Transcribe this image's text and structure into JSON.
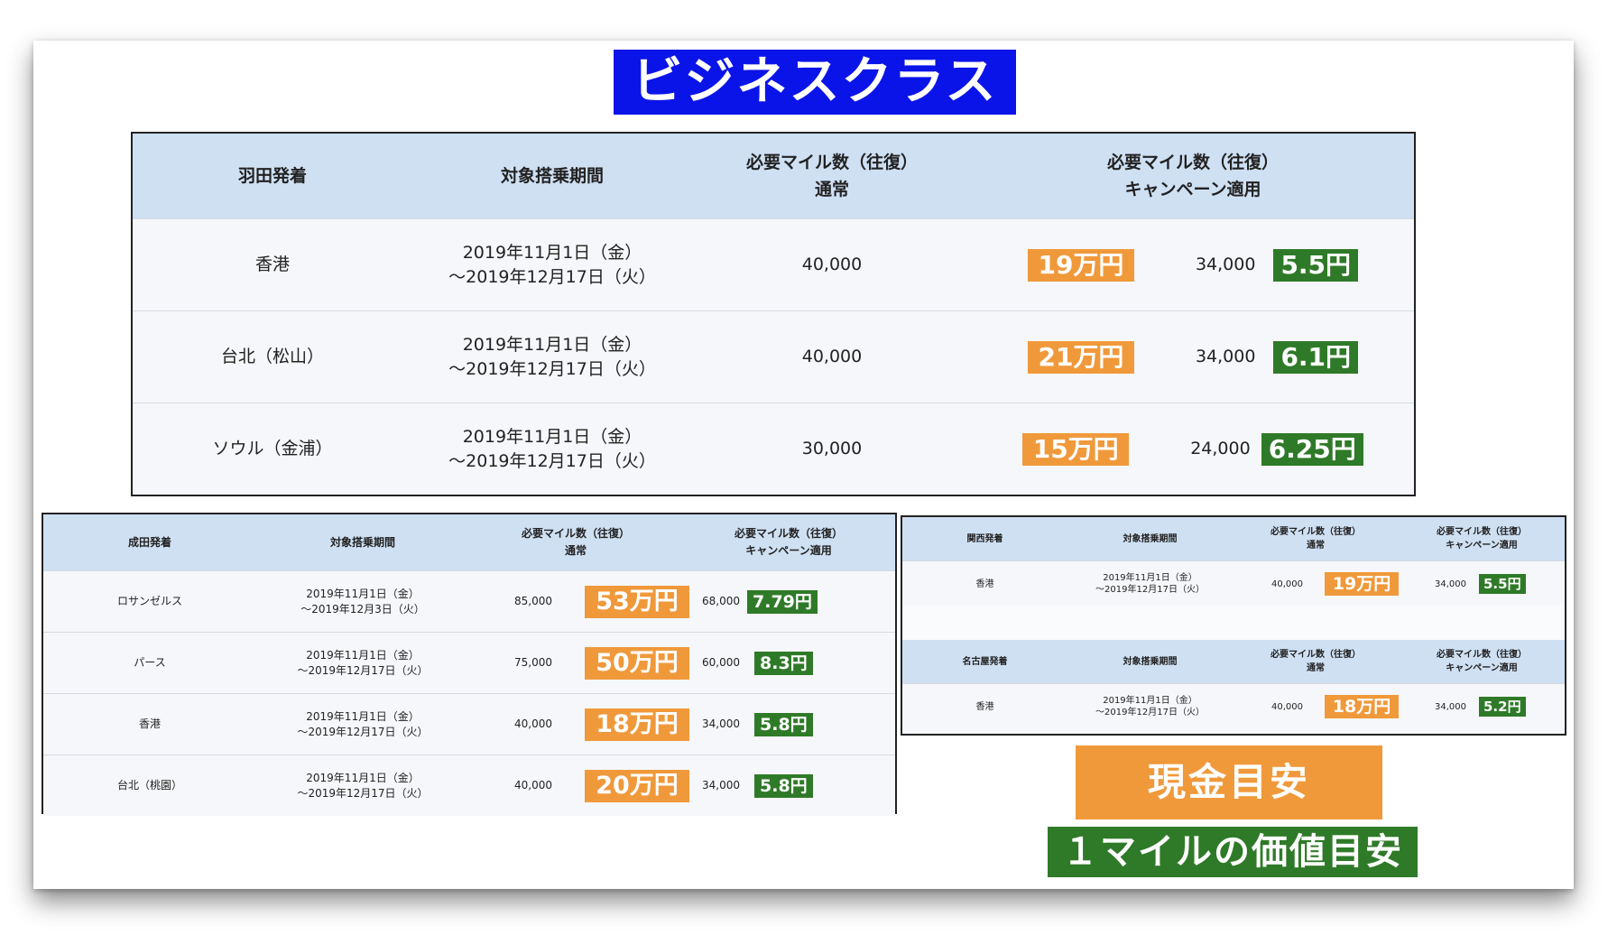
{
  "title": "ビジネスクラス",
  "main": {
    "headers": {
      "origin": "羽田発着",
      "period": "対象搭乗期間",
      "normal_line1": "必要マイル数（往復）",
      "normal_line2": "通常",
      "campaign_line1": "必要マイル数（往復）",
      "campaign_line2": "キャンペーン適用"
    },
    "rows": [
      {
        "dest": "香港",
        "p1": "2019年11月1日（金）",
        "p2": "～2019年12月17日（火）",
        "normal": "40,000",
        "cash": "19万円",
        "campaign": "34,000",
        "value": "5.5円"
      },
      {
        "dest": "台北（松山）",
        "p1": "2019年11月1日（金）",
        "p2": "～2019年12月17日（火）",
        "normal": "40,000",
        "cash": "21万円",
        "campaign": "34,000",
        "value": "6.1円"
      },
      {
        "dest": "ソウル（金浦）",
        "p1": "2019年11月1日（金）",
        "p2": "～2019年12月17日（火）",
        "normal": "30,000",
        "cash": "15万円",
        "campaign": "24,000",
        "value": "6.25円"
      }
    ]
  },
  "narita": {
    "headers": {
      "origin": "成田発着",
      "period": "対象搭乗期間",
      "normal_line1": "必要マイル数（往復）",
      "normal_line2": "通常",
      "campaign_line1": "必要マイル数（往復）",
      "campaign_line2": "キャンペーン適用"
    },
    "rows": [
      {
        "dest": "ロサンゼルス",
        "p1": "2019年11月1日（金）",
        "p2": "～2019年12月3日（火）",
        "normal": "85,000",
        "cash": "53万円",
        "campaign": "68,000",
        "value": "7.79円"
      },
      {
        "dest": "パース",
        "p1": "2019年11月1日（金）",
        "p2": "～2019年12月17日（火）",
        "normal": "75,000",
        "cash": "50万円",
        "campaign": "60,000",
        "value": "8.3円"
      },
      {
        "dest": "香港",
        "p1": "2019年11月1日（金）",
        "p2": "～2019年12月17日（火）",
        "normal": "40,000",
        "cash": "18万円",
        "campaign": "34,000",
        "value": "5.8円"
      },
      {
        "dest": "台北（桃園）",
        "p1": "2019年11月1日（金）",
        "p2": "～2019年12月17日（火）",
        "normal": "40,000",
        "cash": "20万円",
        "campaign": "34,000",
        "value": "5.8円"
      }
    ]
  },
  "kansai": {
    "headers": {
      "origin": "関西発着",
      "period": "対象搭乗期間",
      "normal_line1": "必要マイル数（往復）",
      "normal_line2": "通常",
      "campaign_line1": "必要マイル数（往復）",
      "campaign_line2": "キャンペーン適用"
    },
    "rows": [
      {
        "dest": "香港",
        "p1": "2019年11月1日（金）",
        "p2": "～2019年12月17日（火）",
        "normal": "40,000",
        "cash": "19万円",
        "campaign": "34,000",
        "value": "5.5円"
      }
    ]
  },
  "nagoya": {
    "headers": {
      "origin": "名古屋発着",
      "period": "対象搭乗期間",
      "normal_line1": "必要マイル数（往復）",
      "normal_line2": "通常",
      "campaign_line1": "必要マイル数（往復）",
      "campaign_line2": "キャンペーン適用"
    },
    "rows": [
      {
        "dest": "香港",
        "p1": "2019年11月1日（金）",
        "p2": "～2019年12月17日（火）",
        "normal": "40,000",
        "cash": "18万円",
        "campaign": "34,000",
        "value": "5.2円"
      }
    ]
  },
  "legend": {
    "cash": "現金目安",
    "mile_value": "１マイルの価値目安"
  },
  "colors": {
    "title_bg": "#0b14e8",
    "header_bg": "#cfe0f3",
    "cash_badge": "#f0993b",
    "value_badge": "#2f7a28"
  }
}
